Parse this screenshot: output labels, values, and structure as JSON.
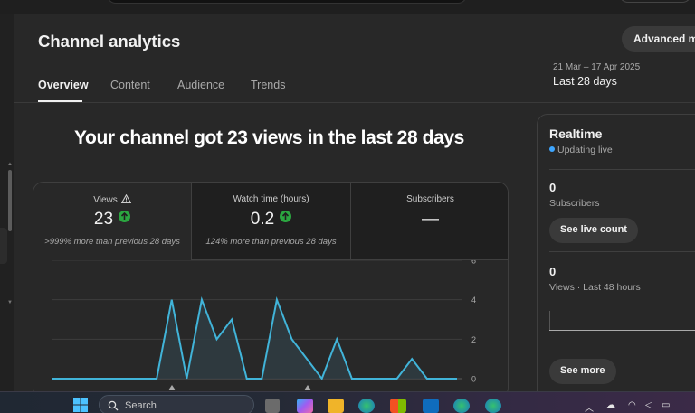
{
  "header": {
    "title": "Channel analytics",
    "advanced_mode_label": "Advanced mode"
  },
  "tabs": [
    {
      "label": "Overview",
      "active": true
    },
    {
      "label": "Content",
      "active": false
    },
    {
      "label": "Audience",
      "active": false
    },
    {
      "label": "Trends",
      "active": false
    }
  ],
  "date": {
    "range": "21 Mar – 17 Apr 2025",
    "label": "Last 28 days"
  },
  "headline": "Your channel got 23 views in the last 28 days",
  "metrics": [
    {
      "label": "Views",
      "value": "23",
      "sub": ">999% more than previous 28 days",
      "trend": "up",
      "icon": "warning-icon"
    },
    {
      "label": "Watch time (hours)",
      "value": "0.2",
      "sub": "124% more than previous 28 days",
      "trend": "up"
    },
    {
      "label": "Subscribers",
      "value": "—",
      "sub": "",
      "trend": "none"
    }
  ],
  "chart_data": {
    "type": "area",
    "x": [
      1,
      2,
      3,
      4,
      5,
      6,
      7,
      8,
      9,
      10,
      11,
      12,
      13,
      14,
      15,
      16,
      17,
      18,
      19,
      20,
      21,
      22,
      23,
      24,
      25,
      26,
      27,
      28
    ],
    "series": [
      {
        "values": [
          0,
          0,
          0,
          0,
          0,
          0,
          0,
          0,
          4,
          0,
          4,
          2,
          3,
          0,
          0,
          4,
          2,
          1,
          0,
          2,
          0,
          0,
          0,
          0,
          1,
          0,
          0,
          0
        ]
      }
    ],
    "y_ticks": [
      "6",
      "4",
      "2",
      "0"
    ],
    "ylim": [
      0,
      6
    ],
    "grid": true,
    "line_color": "#41b4d9",
    "fill_color": "#2f3c42",
    "axis_side": "right"
  },
  "realtime": {
    "title": "Realtime",
    "status": "Updating live",
    "subscribers_value": "0",
    "subscribers_label": "Subscribers",
    "see_live_count_label": "See live count",
    "views_value": "0",
    "views_label": "Views · Last 48 hours",
    "see_more_label": "See more"
  },
  "taskbar": {
    "search_placeholder": "Search"
  },
  "colors": {
    "background": "#282828",
    "accent_green": "#2ba640",
    "live_blue": "#3ea6ff"
  }
}
